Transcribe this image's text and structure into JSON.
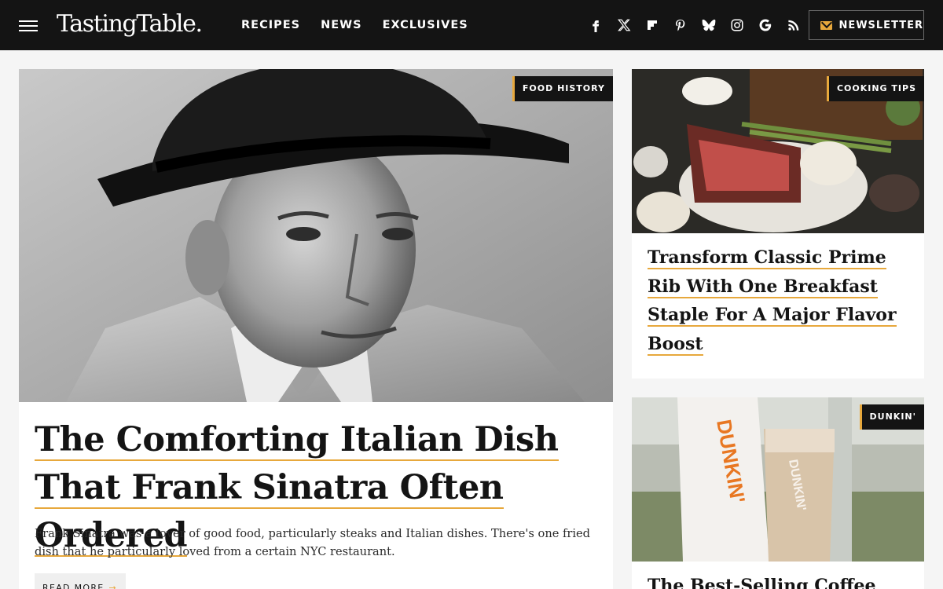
{
  "header": {
    "logo": "TastingTable.",
    "nav": [
      "RECIPES",
      "NEWS",
      "EXCLUSIVES"
    ],
    "social_icons": [
      "facebook-icon",
      "x-icon",
      "flipboard-icon",
      "pinterest-icon",
      "bluesky-icon",
      "instagram-icon",
      "google-icon",
      "rss-icon"
    ],
    "newsletter_label": "NEWSLETTER"
  },
  "featured": {
    "tag": "FOOD HISTORY",
    "title": "The Comforting Italian Dish That Frank Sinatra Often Ordered",
    "description": "Frank Sinatra was a lover of good food, particularly steaks and Italian dishes. There's one fried dish that he particularly loved from a certain NYC restaurant.",
    "read_more": "READ MORE",
    "read_more_arrow": "→"
  },
  "side": [
    {
      "tag": "COOKING TIPS",
      "title": "Transform Classic Prime Rib With One Breakfast Staple For A Major Flavor Boost"
    },
    {
      "tag": "DUNKIN'",
      "title": "The Best-Selling Coffee",
      "brand_cup_text": "DUNKIN'"
    }
  ],
  "colors": {
    "header_bg": "#141414",
    "accent": "#e7a83c",
    "page_bg": "#f5f5f5"
  }
}
